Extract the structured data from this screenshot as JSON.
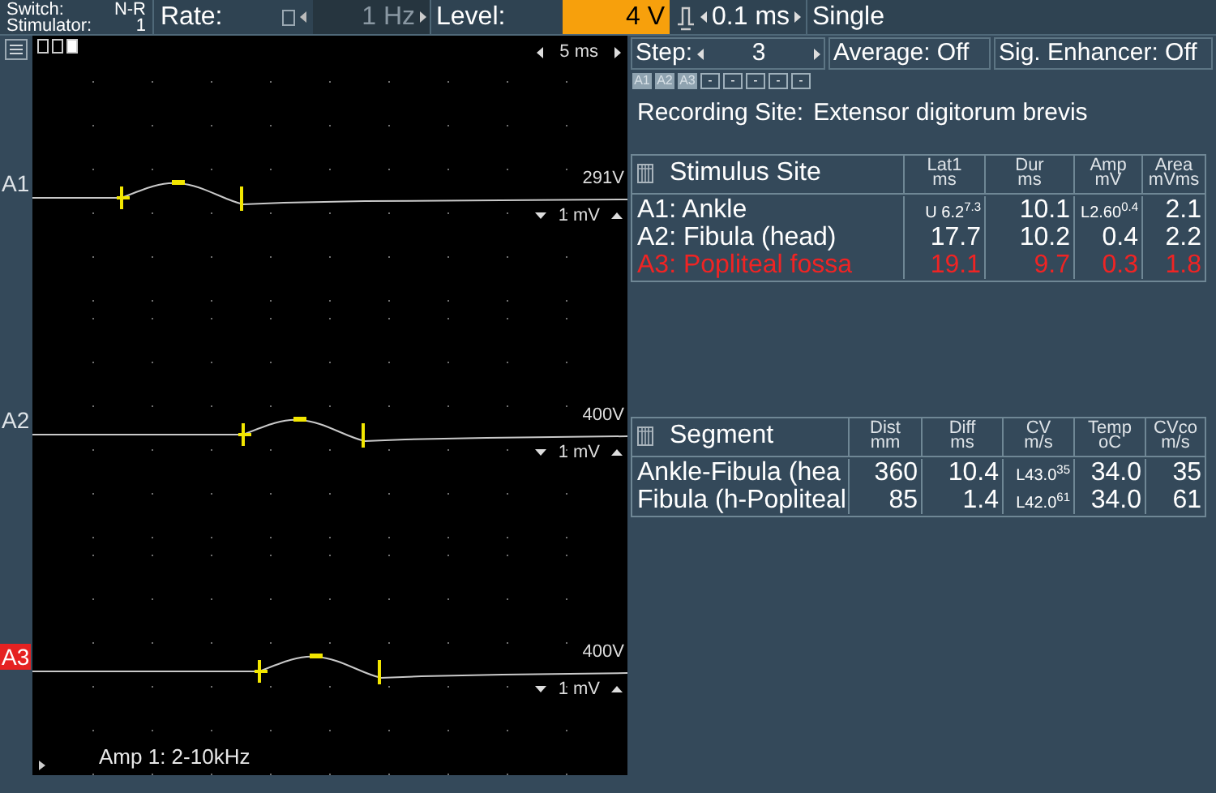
{
  "toolbar": {
    "switch_label": "Switch:",
    "switch_value": "N-R",
    "stimulator_label": "Stimulator:",
    "stimulator_value": "1",
    "rate_label": "Rate:",
    "rate_value": "1 Hz",
    "level_label": "Level:",
    "level_value": "4 V",
    "pulse_width": "0.1 ms",
    "mode": "Single"
  },
  "view_boxes": [
    {
      "checked": false
    },
    {
      "checked": false
    },
    {
      "checked": true
    }
  ],
  "timebase": "5 ms",
  "traces": [
    {
      "label": "A1",
      "selected": false,
      "value": "291V",
      "scale": "1 mV"
    },
    {
      "label": "A2",
      "selected": false,
      "value": "400V",
      "scale": "1 mV"
    },
    {
      "label": "A3",
      "selected": true,
      "value": "400V",
      "scale": "1 mV"
    }
  ],
  "filter": "Amp 1: 2-10kHz",
  "controls": {
    "step_label": "Step:",
    "step_value": "3",
    "average": "Average: Off",
    "sig_enhancer": "Sig. Enhancer: Off"
  },
  "channel_buttons": [
    {
      "label": "A1",
      "kind": "trace"
    },
    {
      "label": "A2",
      "kind": "trace"
    },
    {
      "label": "A3",
      "kind": "trace"
    },
    {
      "label": "-",
      "kind": "empty"
    },
    {
      "label": "-",
      "kind": "empty"
    },
    {
      "label": "-",
      "kind": "empty"
    },
    {
      "label": "-",
      "kind": "empty"
    },
    {
      "label": "-",
      "kind": "empty"
    }
  ],
  "recording_site": {
    "label": "Recording Site:",
    "value": "Extensor digitorum brevis"
  },
  "stimulus_table": {
    "columns": [
      {
        "name": "Stimulus Site"
      },
      {
        "name": "Lat1",
        "unit": "ms"
      },
      {
        "name": "Dur",
        "unit": "ms"
      },
      {
        "name": "Amp",
        "unit": "mV"
      },
      {
        "name": "Area",
        "unit": "mVms"
      }
    ],
    "rows": [
      {
        "selected": false,
        "cells": [
          "A1: Ankle",
          "U 6.2$^{7.3}$",
          "10.1",
          "L2.60$^{0.4}$",
          "2.1"
        ]
      },
      {
        "selected": false,
        "cells": [
          "A2: Fibula (head)",
          "17.7",
          "10.2",
          "0.4",
          "2.2"
        ]
      },
      {
        "selected": true,
        "cells": [
          "A3: Popliteal fossa",
          "19.1",
          "9.7",
          "0.3",
          "1.8"
        ]
      }
    ]
  },
  "segment_table": {
    "columns": [
      {
        "name": "Segment"
      },
      {
        "name": "Dist",
        "unit": "mm"
      },
      {
        "name": "Diff",
        "unit": "ms"
      },
      {
        "name": "CV",
        "unit": "m/s"
      },
      {
        "name": "Temp",
        "unit": "oC"
      },
      {
        "name": "CVco",
        "unit": "m/s"
      }
    ],
    "rows": [
      {
        "cells": [
          "Ankle-Fibula (hea",
          "360",
          "10.4",
          "L43.0$^{35}$",
          "34.0",
          "35"
        ]
      },
      {
        "cells": [
          "Fibula (h-Popliteal",
          "85",
          "1.4",
          "L42.0$^{61}$",
          "34.0",
          "61"
        ]
      }
    ]
  }
}
